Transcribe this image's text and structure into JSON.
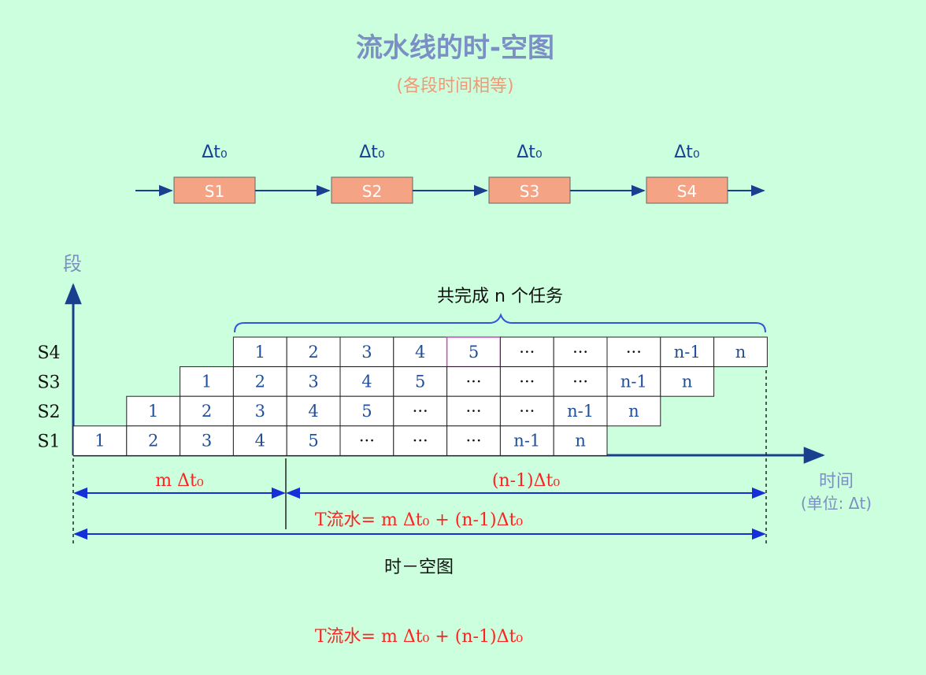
{
  "title": "流水线的时-空图",
  "subtitle": "(各段时间相等)",
  "pipeline": {
    "stage_time_label": "Δt₀",
    "stages": [
      "S1",
      "S2",
      "S3",
      "S4"
    ]
  },
  "diagram": {
    "y_axis_label": "段",
    "x_axis_label": "时间",
    "x_axis_unit": "(单位: Δt)",
    "brace_label": "共完成 n 个任务",
    "rows": [
      {
        "stage": "S4",
        "cells": [
          "1",
          "2",
          "3",
          "4",
          "5",
          "···",
          "···",
          "···",
          "n-1",
          "n"
        ]
      },
      {
        "stage": "S3",
        "cells": [
          "1",
          "2",
          "3",
          "4",
          "5",
          "···",
          "···",
          "···",
          "n-1",
          "n"
        ]
      },
      {
        "stage": "S2",
        "cells": [
          "1",
          "2",
          "3",
          "4",
          "5",
          "···",
          "···",
          "···",
          "n-1",
          "n"
        ]
      },
      {
        "stage": "S1",
        "cells": [
          "1",
          "2",
          "3",
          "4",
          "5",
          "···",
          "···",
          "···",
          "n-1",
          "n"
        ]
      }
    ],
    "highlight_cell": {
      "row": "S4",
      "cell": "5"
    },
    "dim_left_label": "m Δt₀",
    "dim_right_label": "(n-1)Δt₀",
    "total_label": "T流水= m Δt₀ + (n-1)Δt₀",
    "caption": "时－空图"
  },
  "formula": "T流水= m Δt₀ + (n-1)Δt₀",
  "colors": {
    "background": "#ccffdd",
    "title": "#7b8fc4",
    "subtitle": "#ee9977",
    "stage_box": "#f4a484",
    "axis": "#1a3f8f",
    "cell_text": "#1f4e9c",
    "dim_line": "#1530d8",
    "brace": "#3355dd",
    "red_text": "#ff2222",
    "highlight": "#c34bbd"
  }
}
